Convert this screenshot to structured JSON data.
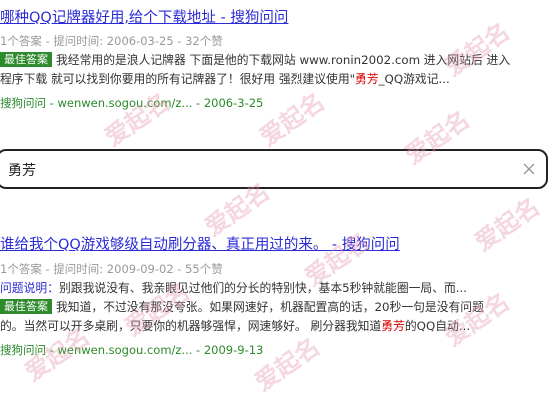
{
  "results": [
    {
      "title": "哪种QQ记牌器好用,给个下载地址 - 搜狗问问",
      "meta": "1个答案 - 提问时间: 2006-03-25 - 32个赞",
      "badge": "最佳答案",
      "answer_line1": "我经常用的是浪人记牌器 下面是他的下载网站 www.ronin2002.com 进入网站后 进入",
      "answer_line2_a": "程序下载 就可以找到你要用的所有记牌器了！很好用 强烈建议使用\"",
      "answer_line2_hl": "勇芳",
      "answer_line2_b": "_QQ游戏记...",
      "source": "搜狗问问 - wenwen.sogou.com/z... - 2006-3-25"
    },
    {
      "title": "谁给我个QQ游戏够级自动刷分器、真正用过的来。 - 搜狗问问",
      "meta": "1个答案 - 提问时间: 2009-09-02 - 55个赞",
      "question_label": "问题说明：",
      "question_text": "别跟我说没有、我亲眼见过他们的分长的特别快，基本5秒钟就能圈一局、而...",
      "badge": "最佳答案",
      "answer_line1": "我知道，不过没有那没夸张。如果网速好，机器配置高的话，20秒一句是没有问题",
      "answer_line2_a": "的。当然可以开多桌刷，只要你的机器够强悍，网速够好。 刷分器我知道",
      "answer_line2_hl": "勇芳",
      "answer_line2_b": "的QQ自动...",
      "source": "搜狗问问 - wenwen.sogou.com/z... - 2009-9-13"
    }
  ],
  "search": {
    "value": "勇芳",
    "clear_icon": "close-icon"
  },
  "watermark": {
    "text": "爱起名",
    "color": "#e696aa"
  }
}
